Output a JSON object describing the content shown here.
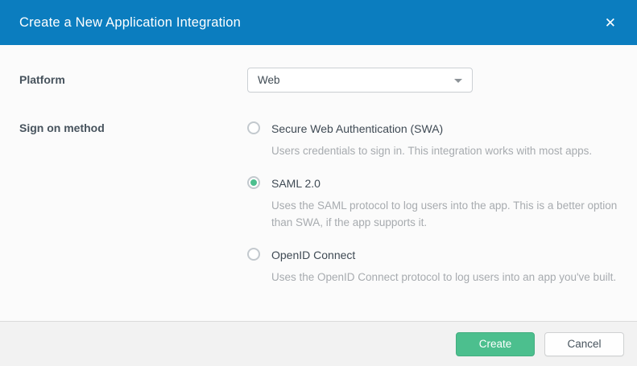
{
  "colors": {
    "header_bg": "#0b7dbf",
    "body_bg": "#fbfbfb",
    "footer_bg": "#f2f2f2",
    "accent_green": "#4cbf8e"
  },
  "header": {
    "title": "Create a New Application Integration",
    "close_icon": "✕"
  },
  "form": {
    "platform": {
      "label": "Platform",
      "value": "Web"
    },
    "sign_on": {
      "label": "Sign on method",
      "options": [
        {
          "label": "Secure Web Authentication (SWA)",
          "description": "Users credentials to sign in. This integration works with most apps.",
          "selected": false
        },
        {
          "label": "SAML 2.0",
          "description": "Uses the SAML protocol to log users into the app. This is a better option than SWA, if the app supports it.",
          "selected": true
        },
        {
          "label": "OpenID Connect",
          "description": "Uses the OpenID Connect protocol to log users into an app you've built.",
          "selected": false
        }
      ]
    }
  },
  "footer": {
    "create_label": "Create",
    "cancel_label": "Cancel"
  }
}
